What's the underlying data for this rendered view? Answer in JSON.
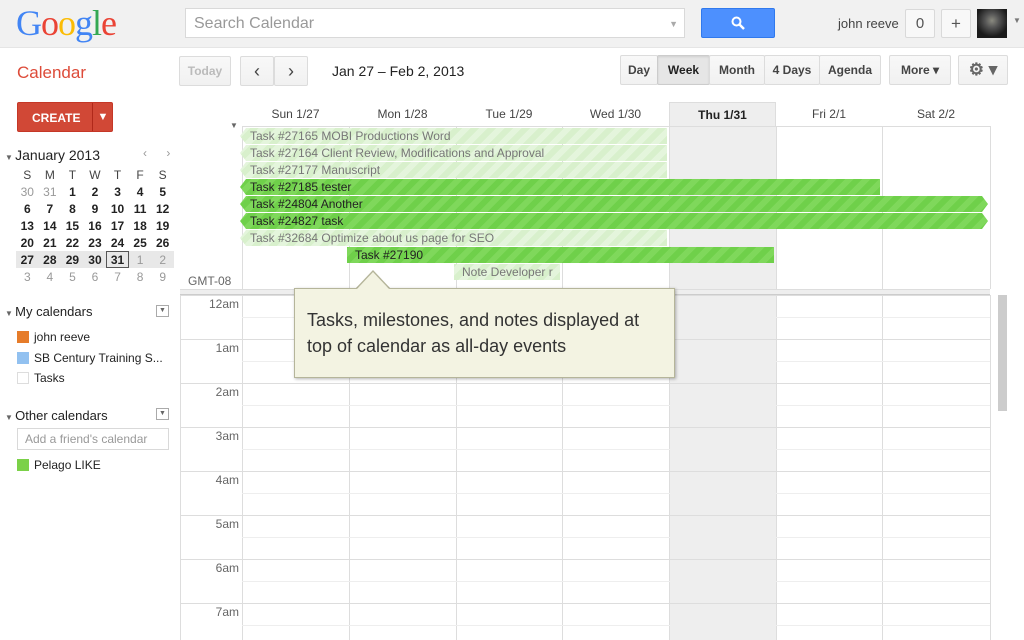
{
  "header": {
    "logo": "Google",
    "search_placeholder": "Search Calendar",
    "user": "john reeve",
    "notifications": "0",
    "share": "+"
  },
  "toolbar": {
    "app_title": "Calendar",
    "today": "Today",
    "prev": "‹",
    "next": "›",
    "date_range": "Jan 27 – Feb 2, 2013",
    "views": [
      "Day",
      "Week",
      "Month",
      "4 Days",
      "Agenda"
    ],
    "active_view": "Week",
    "more": "More ▾",
    "settings": "⚙ ▾"
  },
  "sidebar": {
    "create": "CREATE",
    "create_dd": "▼",
    "mini_cal": {
      "title": "January 2013",
      "nav": "‹ ›",
      "weekdays": [
        "S",
        "M",
        "T",
        "W",
        "T",
        "F",
        "S"
      ],
      "weeks": [
        [
          "30",
          "31",
          "1",
          "2",
          "3",
          "4",
          "5"
        ],
        [
          "6",
          "7",
          "8",
          "9",
          "10",
          "11",
          "12"
        ],
        [
          "13",
          "14",
          "15",
          "16",
          "17",
          "18",
          "19"
        ],
        [
          "20",
          "21",
          "22",
          "23",
          "24",
          "25",
          "26"
        ],
        [
          "27",
          "28",
          "29",
          "30",
          "31",
          "1",
          "2"
        ],
        [
          "3",
          "4",
          "5",
          "6",
          "7",
          "8",
          "9"
        ]
      ],
      "today": "31"
    },
    "my_calendars": {
      "title": "My calendars",
      "items": [
        {
          "label": "john reeve",
          "color": "#e67c2a"
        },
        {
          "label": "SB Century Training S...",
          "color": "#92c1f0"
        },
        {
          "label": "Tasks",
          "color": "#ffffff"
        }
      ]
    },
    "other_calendars": {
      "title": "Other calendars",
      "placeholder": "Add a friend's calendar",
      "items": [
        {
          "label": "Pelago LIKE",
          "color": "#7bd148"
        }
      ]
    }
  },
  "grid": {
    "days": [
      "Sun 1/27",
      "Mon 1/28",
      "Tue 1/29",
      "Wed 1/30",
      "Thu 1/31",
      "Fri 2/1",
      "Sat 2/2"
    ],
    "today_index": 4,
    "timezone": "GMT-08",
    "hours": [
      "12am",
      "1am",
      "2am",
      "3am",
      "4am",
      "5am",
      "6am",
      "7am"
    ],
    "allday": [
      {
        "text": "Task #27165  MOBI Productions Word",
        "style": "light",
        "start": 0,
        "end": 4,
        "arrow": "left"
      },
      {
        "text": "Task #27164  Client Review, Modifications and Approval",
        "style": "light",
        "start": 0,
        "end": 4,
        "arrow": "left"
      },
      {
        "text": "Task #27177  Manuscript",
        "style": "light",
        "start": 0,
        "end": 4,
        "arrow": "left"
      },
      {
        "text": "Task #27185  tester",
        "style": "dark",
        "start": 0,
        "end": 6,
        "arrow": "left"
      },
      {
        "text": "Task #24804  Another",
        "style": "dark",
        "start": 0,
        "end": 7,
        "arrow": "both"
      },
      {
        "text": "Task #24827   task",
        "style": "dark",
        "start": 0,
        "end": 7,
        "arrow": "both"
      },
      {
        "text": "Task #32684  Optimize about us page for SEO",
        "style": "light",
        "start": 0,
        "end": 4,
        "arrow": "left"
      },
      {
        "text": "Task #27190",
        "style": "dark",
        "start": 1,
        "end": 5,
        "arrow": "none"
      },
      {
        "text": "Note  Developer r",
        "style": "light",
        "start": 2,
        "end": 3,
        "arrow": "none"
      }
    ]
  },
  "callout": {
    "text": "Tasks, milestones, and notes displayed at top of calendar as all-day events"
  }
}
